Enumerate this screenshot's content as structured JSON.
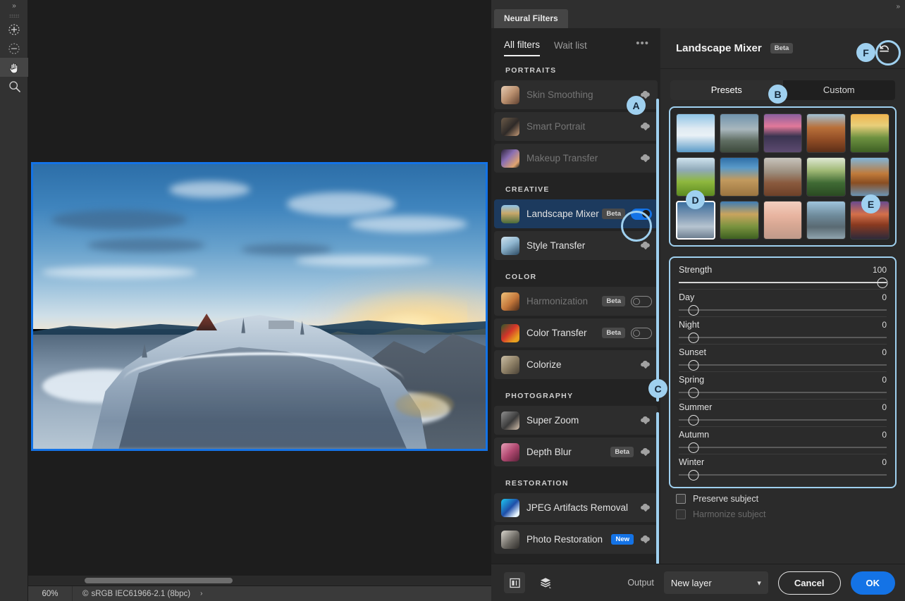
{
  "app": {
    "zoom_level": "60%",
    "color_profile": "sRGB IEC61966-2.1 (8bpc)",
    "color_profile_icon": "copyright-icon",
    "profile_arrow": "›",
    "collapse_chevron": "»"
  },
  "toolbar": {
    "expand_label": "»",
    "tools": [
      {
        "name": "add-to-selection-tool",
        "icon": "plus-circle-dashed-icon"
      },
      {
        "name": "subtract-from-selection-tool",
        "icon": "minus-circle-dashed-icon"
      },
      {
        "name": "hand-tool",
        "icon": "hand-icon",
        "active": true
      },
      {
        "name": "zoom-tool",
        "icon": "magnifier-icon"
      }
    ]
  },
  "panel": {
    "tab_label": "Neural Filters",
    "right_chevron": "»"
  },
  "filters": {
    "subtabs": [
      {
        "label": "All filters",
        "active": true
      },
      {
        "label": "Wait list",
        "active": false
      }
    ],
    "overflow_icon": "•••",
    "groups": [
      {
        "title": "PORTRAITS",
        "items": [
          {
            "label": "Skin Smoothing",
            "state": "download",
            "dim": true,
            "badge": null,
            "thumb": "portrait-skin"
          },
          {
            "label": "Smart Portrait",
            "state": "download",
            "dim": true,
            "badge": null,
            "thumb": "portrait-man"
          },
          {
            "label": "Makeup Transfer",
            "state": "download",
            "dim": true,
            "badge": null,
            "thumb": "portrait-makeup"
          }
        ]
      },
      {
        "title": "CREATIVE",
        "items": [
          {
            "label": "Landscape Mixer",
            "state": "toggle-on",
            "dim": false,
            "badge": "Beta",
            "thumb": "landscape",
            "selected": true
          },
          {
            "label": "Style Transfer",
            "state": "download",
            "dim": false,
            "badge": null,
            "thumb": "style-art"
          }
        ]
      },
      {
        "title": "COLOR",
        "items": [
          {
            "label": "Harmonization",
            "state": "toggle-off",
            "dim": true,
            "badge": "Beta",
            "thumb": "harmony-woman"
          },
          {
            "label": "Color Transfer",
            "state": "toggle-off",
            "dim": false,
            "badge": "Beta",
            "thumb": "color-flower"
          },
          {
            "label": "Colorize",
            "state": "download",
            "dim": false,
            "badge": null,
            "thumb": "colorize-old"
          }
        ]
      },
      {
        "title": "PHOTOGRAPHY",
        "items": [
          {
            "label": "Super Zoom",
            "state": "download",
            "dim": false,
            "badge": null,
            "thumb": "superzoom-face"
          },
          {
            "label": "Depth Blur",
            "state": "download",
            "dim": false,
            "badge": "Beta",
            "thumb": "depth-pink"
          }
        ]
      },
      {
        "title": "RESTORATION",
        "items": [
          {
            "label": "JPEG Artifacts Removal",
            "state": "download",
            "dim": false,
            "badge": null,
            "thumb": "jpeg-gem"
          },
          {
            "label": "Photo Restoration",
            "state": "download",
            "dim": false,
            "badge": "New",
            "thumb": "restore-old"
          }
        ]
      }
    ]
  },
  "detail": {
    "title": "Landscape Mixer",
    "title_badge": "Beta",
    "reset_icon": "reset-undo-icon",
    "segments": [
      {
        "label": "Presets",
        "active": true
      },
      {
        "label": "Custom",
        "active": false
      }
    ],
    "presets": [
      {
        "name": "glacier-lake",
        "selected": false
      },
      {
        "name": "alpine-valley",
        "selected": false
      },
      {
        "name": "matterhorn-dusk",
        "selected": false
      },
      {
        "name": "red-canyon",
        "selected": false
      },
      {
        "name": "green-sunrise",
        "selected": false
      },
      {
        "name": "spring-meadow",
        "selected": false
      },
      {
        "name": "desert-cliff",
        "selected": false
      },
      {
        "name": "monument-valley",
        "selected": false
      },
      {
        "name": "river-bend",
        "selected": false
      },
      {
        "name": "basalt-coast",
        "selected": false
      },
      {
        "name": "snow-peaks",
        "selected": true
      },
      {
        "name": "yosemite-fall",
        "selected": false
      },
      {
        "name": "pink-lake",
        "selected": false
      },
      {
        "name": "rocky-beach",
        "selected": false
      },
      {
        "name": "sunset-shore",
        "selected": false
      }
    ],
    "sliders": [
      {
        "label": "Strength",
        "value": 100,
        "max": 100
      },
      {
        "label": "Day",
        "value": 0,
        "max": 100
      },
      {
        "label": "Night",
        "value": 0,
        "max": 100
      },
      {
        "label": "Sunset",
        "value": 0,
        "max": 100
      },
      {
        "label": "Spring",
        "value": 0,
        "max": 100
      },
      {
        "label": "Summer",
        "value": 0,
        "max": 100
      },
      {
        "label": "Autumn",
        "value": 0,
        "max": 100
      },
      {
        "label": "Winter",
        "value": 0,
        "max": 100
      }
    ],
    "checkboxes": [
      {
        "label": "Preserve subject",
        "checked": false,
        "disabled": false
      },
      {
        "label": "Harmonize subject",
        "checked": false,
        "disabled": true
      }
    ]
  },
  "footer": {
    "compare_icon": "before-after-icon",
    "layers_icon": "layers-icon",
    "output_label": "Output",
    "output_value": "New layer",
    "output_chevron": "⌄",
    "cancel_label": "Cancel",
    "ok_label": "OK"
  },
  "callouts": [
    {
      "id": "A",
      "target": "landscape-mixer-toggle"
    },
    {
      "id": "B",
      "target": "presets-custom-segmented-control"
    },
    {
      "id": "C",
      "target": "filters-list-scrollbar"
    },
    {
      "id": "D",
      "target": "selected-preset-thumbnail"
    },
    {
      "id": "E",
      "target": "preset-thumbnail-15"
    },
    {
      "id": "F",
      "target": "reset-button"
    }
  ],
  "colors": {
    "accent": "#1473e6",
    "callout": "#9fd0ef",
    "panel_bg": "#2b2b2b",
    "list_bg": "#232323"
  }
}
